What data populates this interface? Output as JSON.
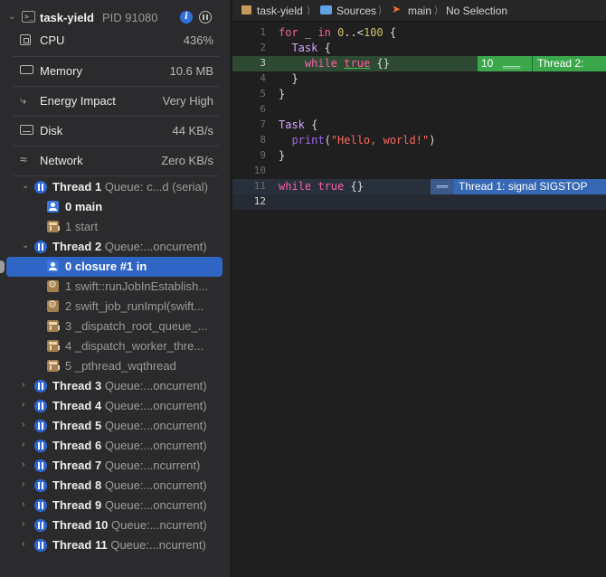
{
  "process": {
    "name": "task-yield",
    "pid": "PID 91080",
    "terminal_glyph": ">_"
  },
  "gauges": [
    {
      "label": "CPU",
      "value": "436%"
    },
    {
      "label": "Memory",
      "value": "10.6 MB"
    },
    {
      "label": "Energy Impact",
      "value": "Very High"
    },
    {
      "label": "Disk",
      "value": "44 KB/s"
    },
    {
      "label": "Network",
      "value": "Zero KB/s"
    }
  ],
  "threads": [
    {
      "name": "Thread 1",
      "queue": "Queue: c...d (serial)",
      "frames": [
        {
          "label": "0 main"
        },
        {
          "label": "1 start"
        }
      ]
    },
    {
      "name": "Thread 2",
      "queue": "Queue:...oncurrent)",
      "frames": [
        {
          "label": "0 closure #1 in"
        },
        {
          "label": "1 swift::runJobInEstablish..."
        },
        {
          "label": "2 swift_job_runImpl(swift..."
        },
        {
          "label": "3 _dispatch_root_queue_..."
        },
        {
          "label": "4 _dispatch_worker_thre..."
        },
        {
          "label": "5 _pthread_wqthread"
        }
      ]
    },
    {
      "name": "Thread 3",
      "queue": "Queue:...oncurrent)"
    },
    {
      "name": "Thread 4",
      "queue": "Queue:...oncurrent)"
    },
    {
      "name": "Thread 5",
      "queue": "Queue:...oncurrent)"
    },
    {
      "name": "Thread 6",
      "queue": "Queue:...oncurrent)"
    },
    {
      "name": "Thread 7",
      "queue": "Queue:...ncurrent)"
    },
    {
      "name": "Thread 8",
      "queue": "Queue:...oncurrent)"
    },
    {
      "name": "Thread 9",
      "queue": "Queue:...oncurrent)"
    },
    {
      "name": "Thread 10",
      "queue": "Queue:...ncurrent)"
    },
    {
      "name": "Thread 11",
      "queue": "Queue:...ncurrent)"
    }
  ],
  "jumpbar": {
    "project": "task-yield",
    "folder": "Sources",
    "file": "main",
    "selection": "No Selection"
  },
  "code": {
    "line_numbers": [
      "1",
      "2",
      "3",
      "4",
      "5",
      "6",
      "7",
      "8",
      "9",
      "10",
      "11",
      "12"
    ],
    "line1": {
      "kw1": "for",
      "t1": " _ ",
      "kw2": "in",
      "t2": " ",
      "n1": "0",
      "t3": "..<",
      "n2": "100",
      "t4": " {"
    },
    "line2": {
      "indent": "  ",
      "type": "Task",
      "rest": " {"
    },
    "line3": {
      "indent": "    ",
      "kw": "while",
      "sp": " ",
      "kw2": "true",
      "rest": " {}"
    },
    "line4": {
      "text": "  }"
    },
    "line5": {
      "text": "}"
    },
    "line7": {
      "type": "Task",
      "rest": " {"
    },
    "line8": {
      "indent": "  ",
      "fn": "print",
      "open": "(",
      "str": "\"Hello, world!\"",
      "close": ")"
    },
    "line9": {
      "text": "}"
    },
    "line11": {
      "kw": "while",
      "sp": " ",
      "kw2": "true",
      "rest": " {}"
    }
  },
  "badges": {
    "line3_count": "10",
    "line3_thread": "Thread 2:",
    "line11_thread": "Thread 1: signal SIGSTOP"
  },
  "colors": {
    "selection": "#2f65c4",
    "thread_icon": "#2f66d6",
    "highlight_green": "#3aa84a",
    "highlight_blue": "#3668b4"
  }
}
